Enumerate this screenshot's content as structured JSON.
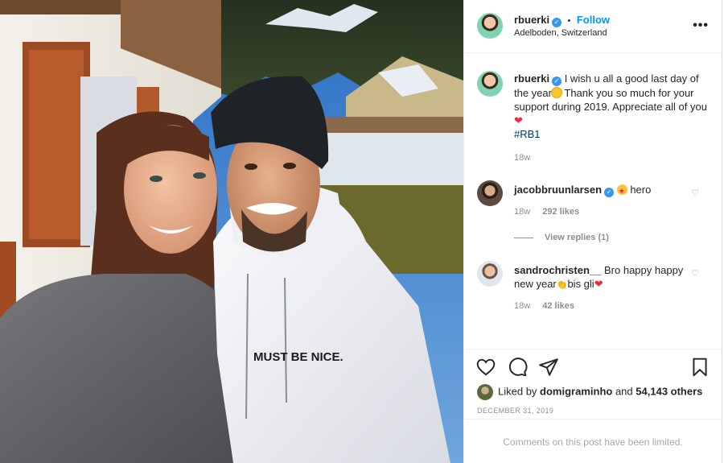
{
  "post": {
    "author": "rbuerki",
    "follow_label": "Follow",
    "separator": "•",
    "location": "Adelboden, Switzerland",
    "more_label": "•••",
    "hoodie_text": "MUST BE NICE."
  },
  "caption": {
    "username": "rbuerki",
    "text_part1": "I wish u all a good last day of the year",
    "text_part2": "Thank you so much for your support during 2019. Appreciate all of you",
    "hashtag": "#RB1",
    "time": "18w"
  },
  "comments": [
    {
      "username": "jacobbruunlarsen",
      "verified": true,
      "text": "hero",
      "time": "18w",
      "likes": "292 likes",
      "view_replies": "View replies (1)"
    },
    {
      "username": "sandrochristen__",
      "verified": false,
      "text_part1": "Bro happy happy new year",
      "text_part2": "bis gli",
      "time": "18w",
      "likes": "42 likes"
    }
  ],
  "likes": {
    "prefix": "Liked by",
    "liker": "domigraminho",
    "joiner": "and",
    "others": "54,143 others"
  },
  "date": "DECEMBER 31, 2019",
  "limited_notice": "Comments on this post have been limited.",
  "icons": {
    "verified": "verified-badge-icon",
    "like": "heart-outline-icon",
    "comment": "speech-bubble-icon",
    "share": "paper-plane-icon",
    "save": "bookmark-icon"
  },
  "colors": {
    "accent": "#0095f6",
    "verified": "#3897f0",
    "muted": "#8e8e8e",
    "heart": "#ed2b3c"
  }
}
